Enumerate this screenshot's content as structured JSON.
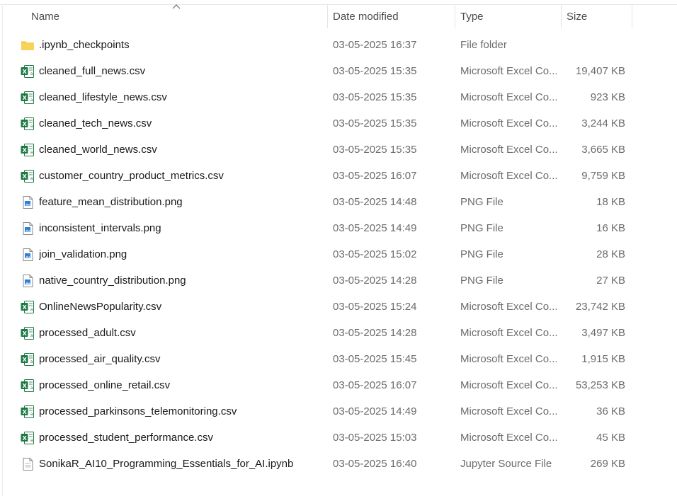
{
  "columns": {
    "name": "Name",
    "date": "Date modified",
    "type": "Type",
    "size": "Size"
  },
  "sort": {
    "column": "name",
    "direction": "ascending",
    "icon": "chevron-up-icon"
  },
  "colors": {
    "header_text": "#4c4c4c",
    "name_text": "#1a1a1a",
    "meta_text": "#6b6b6b",
    "excel_green": "#1d7a45",
    "folder_yellow": "#f4c542",
    "image_blue": "#2f7fd6"
  },
  "files": [
    {
      "icon": "folder-icon",
      "name": ".ipynb_checkpoints",
      "date": "03-05-2025 16:37",
      "type": "File folder",
      "size": ""
    },
    {
      "icon": "excel-icon",
      "name": "cleaned_full_news.csv",
      "date": "03-05-2025 15:35",
      "type": "Microsoft Excel Co...",
      "size": "19,407 KB"
    },
    {
      "icon": "excel-icon",
      "name": "cleaned_lifestyle_news.csv",
      "date": "03-05-2025 15:35",
      "type": "Microsoft Excel Co...",
      "size": "923 KB"
    },
    {
      "icon": "excel-icon",
      "name": "cleaned_tech_news.csv",
      "date": "03-05-2025 15:35",
      "type": "Microsoft Excel Co...",
      "size": "3,244 KB"
    },
    {
      "icon": "excel-icon",
      "name": "cleaned_world_news.csv",
      "date": "03-05-2025 15:35",
      "type": "Microsoft Excel Co...",
      "size": "3,665 KB"
    },
    {
      "icon": "excel-icon",
      "name": "customer_country_product_metrics.csv",
      "date": "03-05-2025 16:07",
      "type": "Microsoft Excel Co...",
      "size": "9,759 KB"
    },
    {
      "icon": "image-icon",
      "name": "feature_mean_distribution.png",
      "date": "03-05-2025 14:48",
      "type": "PNG File",
      "size": "18 KB"
    },
    {
      "icon": "image-icon",
      "name": "inconsistent_intervals.png",
      "date": "03-05-2025 14:49",
      "type": "PNG File",
      "size": "16 KB"
    },
    {
      "icon": "image-icon",
      "name": "join_validation.png",
      "date": "03-05-2025 15:02",
      "type": "PNG File",
      "size": "28 KB"
    },
    {
      "icon": "image-icon",
      "name": "native_country_distribution.png",
      "date": "03-05-2025 14:28",
      "type": "PNG File",
      "size": "27 KB"
    },
    {
      "icon": "excel-icon",
      "name": "OnlineNewsPopularity.csv",
      "date": "03-05-2025 15:24",
      "type": "Microsoft Excel Co...",
      "size": "23,742 KB"
    },
    {
      "icon": "excel-icon",
      "name": "processed_adult.csv",
      "date": "03-05-2025 14:28",
      "type": "Microsoft Excel Co...",
      "size": "3,497 KB"
    },
    {
      "icon": "excel-icon",
      "name": "processed_air_quality.csv",
      "date": "03-05-2025 15:45",
      "type": "Microsoft Excel Co...",
      "size": "1,915 KB"
    },
    {
      "icon": "excel-icon",
      "name": "processed_online_retail.csv",
      "date": "03-05-2025 16:07",
      "type": "Microsoft Excel Co...",
      "size": "53,253 KB"
    },
    {
      "icon": "excel-icon",
      "name": "processed_parkinsons_telemonitoring.csv",
      "date": "03-05-2025 14:49",
      "type": "Microsoft Excel Co...",
      "size": "36 KB"
    },
    {
      "icon": "excel-icon",
      "name": "processed_student_performance.csv",
      "date": "03-05-2025 15:03",
      "type": "Microsoft Excel Co...",
      "size": "45 KB"
    },
    {
      "icon": "document-icon",
      "name": "SonikaR_AI10_Programming_Essentials_for_AI.ipynb",
      "date": "03-05-2025 16:40",
      "type": "Jupyter Source File",
      "size": "269 KB"
    }
  ]
}
